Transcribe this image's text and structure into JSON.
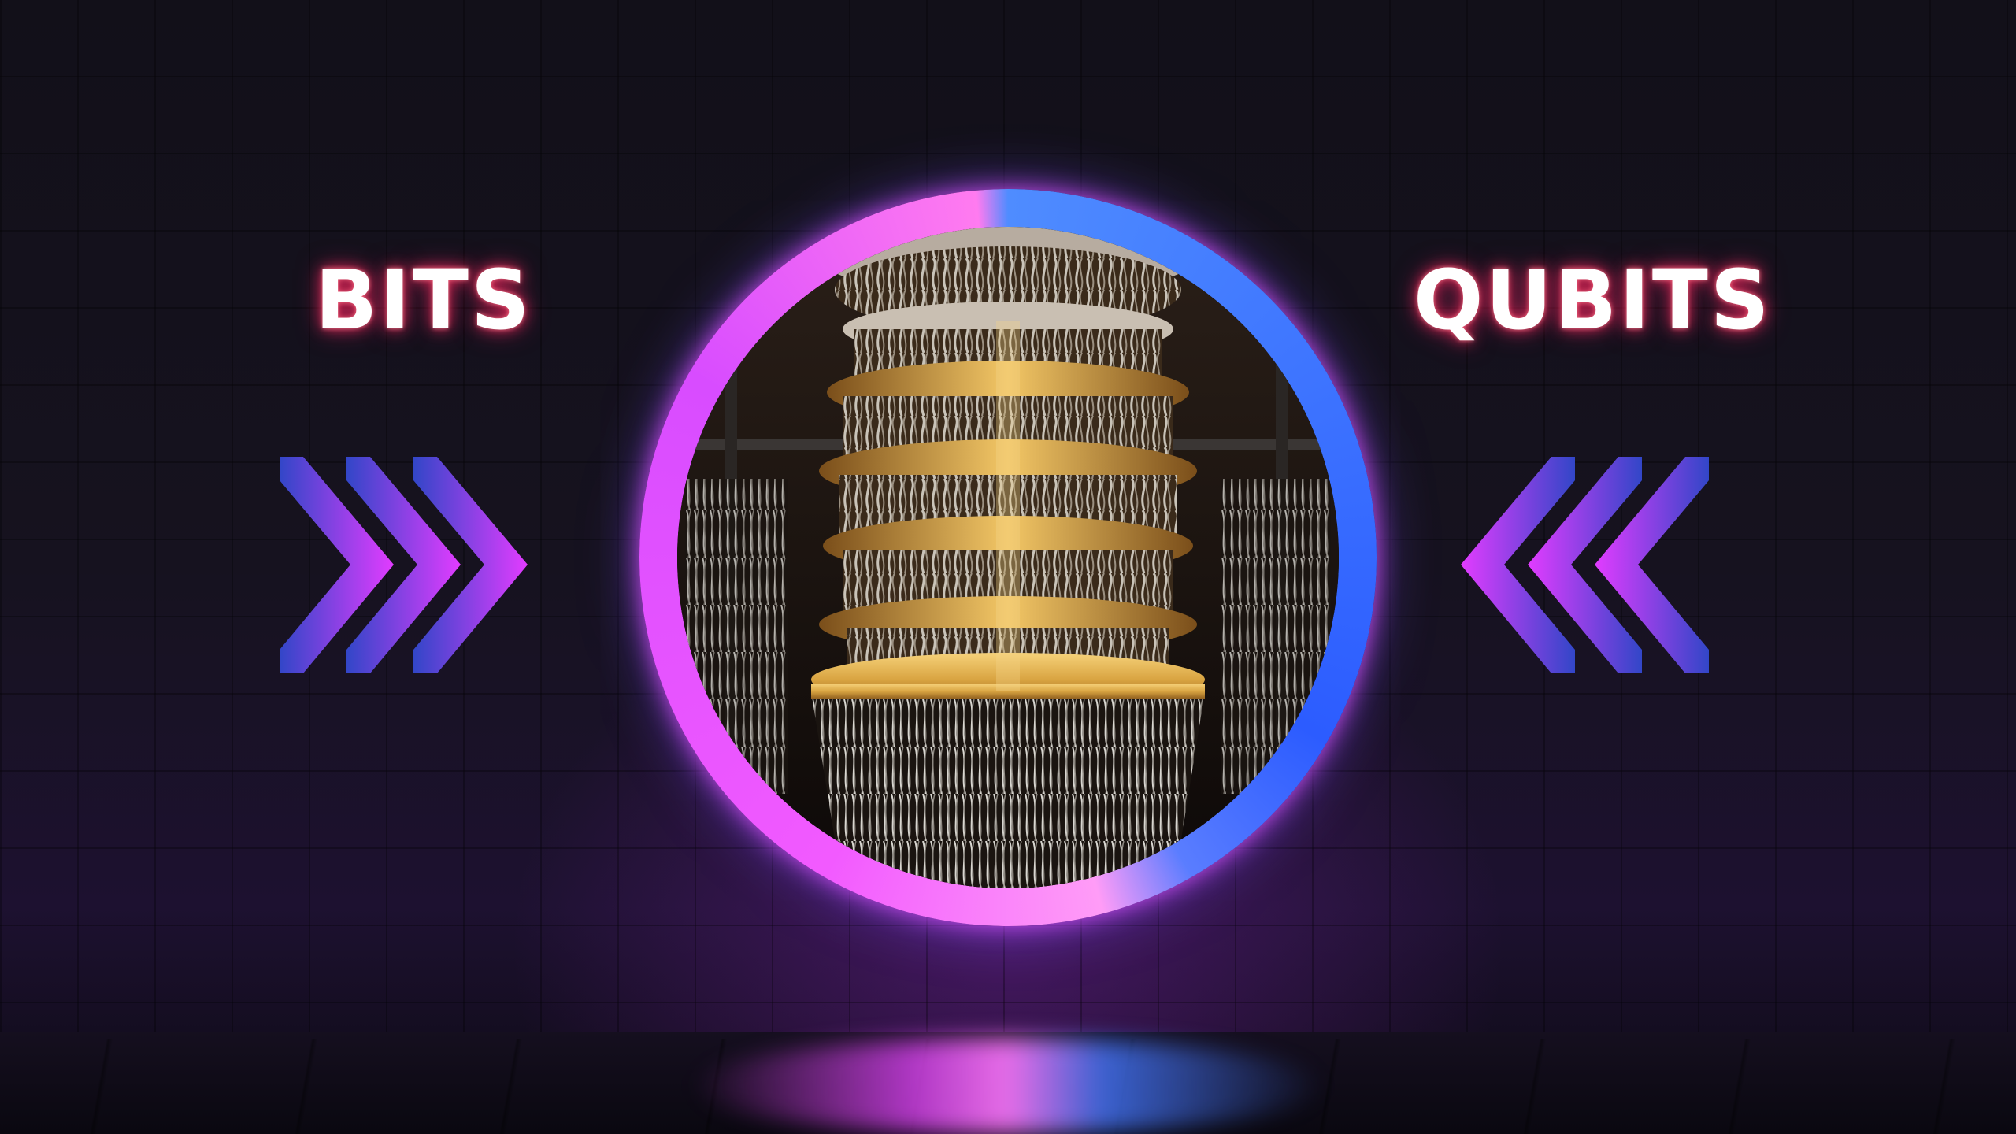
{
  "labels": {
    "left": "BITS",
    "right": "QUBITS"
  },
  "colors": {
    "ring_pink": "#f25aff",
    "ring_blue": "#2c5cff",
    "chevron_magenta": "#e23cff",
    "chevron_blue": "#3246c8",
    "gold": "#d9a441"
  },
  "image": {
    "subject": "quantum-computer-chandelier"
  },
  "icons": {
    "left_arrows": "chevrons-right-icon",
    "right_arrows": "chevrons-left-icon"
  }
}
